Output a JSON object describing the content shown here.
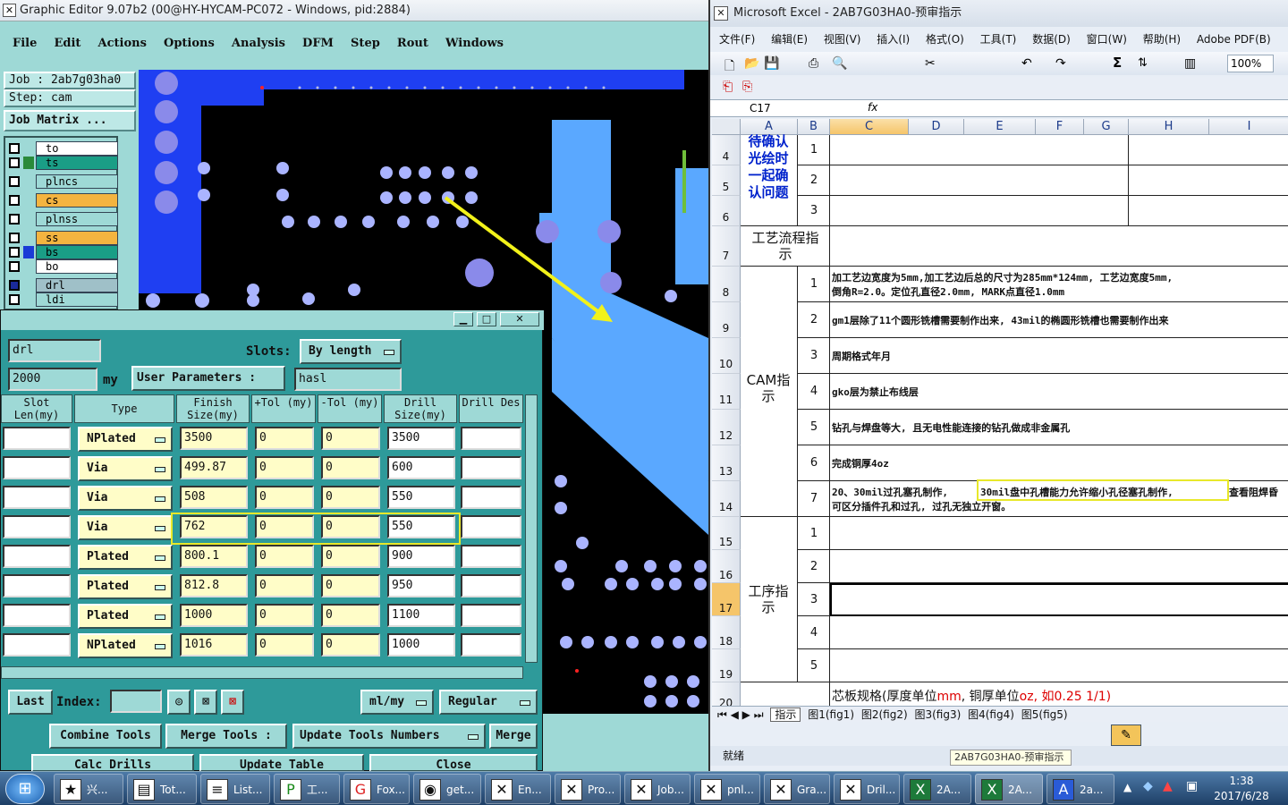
{
  "ge": {
    "title": "Graphic Editor 9.07b2 (00@HY-HYCAM-PC072 - Windows, pid:2884)",
    "menu": [
      "File",
      "Edit",
      "Actions",
      "Options",
      "Analysis",
      "DFM",
      "Step",
      "Rout",
      "Windows"
    ],
    "job_label": "Job : 2ab7g03ha0",
    "step_label": "Step: cam",
    "job_matrix": "Job Matrix ...",
    "layers": [
      {
        "name": "to",
        "color": "#ffffff"
      },
      {
        "name": "ts",
        "color": "#1a9e86"
      },
      {
        "name": "plncs",
        "color": "#9ed9d6"
      },
      {
        "name": "cs",
        "color": "#f4b440"
      },
      {
        "name": "plnss",
        "color": "#9ed9d6"
      },
      {
        "name": "ss",
        "color": "#f4b440"
      },
      {
        "name": "bs",
        "color": "#1a9e86"
      },
      {
        "name": "bo",
        "color": "#ffffff"
      },
      {
        "name": "drl",
        "color": "#9fc0c8"
      },
      {
        "name": "ldi",
        "color": "#9ed9d6"
      }
    ]
  },
  "dlg": {
    "layer_value": "drl",
    "slots_label": "Slots:",
    "slots_value": "By length",
    "thickness_value": "2000",
    "thickness_unit": "my",
    "user_params_label": "User Parameters :",
    "user_params_value": "hasl",
    "headers": [
      "Slot Len(my)",
      "Type",
      "Finish Size(my)",
      "+Tol (my)",
      "-Tol (my)",
      "Drill Size(my)",
      "Drill Des"
    ],
    "rows": [
      {
        "type": "NPlated",
        "finish": "3500",
        "ptol": "0",
        "ntol": "0",
        "drill": "3500"
      },
      {
        "type": "Via",
        "finish": "499.87",
        "ptol": "0",
        "ntol": "0",
        "drill": "600"
      },
      {
        "type": "Via",
        "finish": "508",
        "ptol": "0",
        "ntol": "0",
        "drill": "550"
      },
      {
        "type": "Via",
        "finish": "762",
        "ptol": "0",
        "ntol": "0",
        "drill": "550"
      },
      {
        "type": "Plated",
        "finish": "800.1",
        "ptol": "0",
        "ntol": "0",
        "drill": "900"
      },
      {
        "type": "Plated",
        "finish": "812.8",
        "ptol": "0",
        "ntol": "0",
        "drill": "950"
      },
      {
        "type": "Plated",
        "finish": "1000",
        "ptol": "0",
        "ntol": "0",
        "drill": "1100"
      },
      {
        "type": "NPlated",
        "finish": "1016",
        "ptol": "0",
        "ntol": "0",
        "drill": "1000"
      }
    ],
    "last_label": "Last",
    "index_label": "Index:",
    "unit_value": "ml/my",
    "mode_value": "Regular",
    "buttons": {
      "combine": "Combine Tools",
      "merge_tools": "Merge Tools :",
      "update_numbers": "Update Tools Numbers",
      "merge": "Merge",
      "calc": "Calc Drills",
      "update_table": "Update Table",
      "close": "Close"
    }
  },
  "xl": {
    "title": "Microsoft Excel - 2AB7G03HA0-预审指示",
    "menu": [
      "文件(F)",
      "编辑(E)",
      "视图(V)",
      "插入(I)",
      "格式(O)",
      "工具(T)",
      "数据(D)",
      "窗口(W)",
      "帮助(H)",
      "Adobe PDF(B)"
    ],
    "zoom": "100%",
    "namebox": "C17",
    "fx": "fx",
    "columns": [
      "A",
      "B",
      "C",
      "D",
      "E",
      "F",
      "G",
      "H",
      "I"
    ],
    "rows": [
      "4",
      "5",
      "6",
      "7",
      "8",
      "9",
      "10",
      "11",
      "12",
      "13",
      "14",
      "15",
      "16",
      "17",
      "18",
      "19",
      "20"
    ],
    "group_confirm": "待确认光绘时一起确认问题",
    "group_process": "工艺流程指示",
    "group_cam": "CAM指示",
    "group_step": "工序指示",
    "cam_items": [
      {
        "no": "1",
        "line1": "加工艺边宽度为5mm,加工艺边后总的尺寸为285mm*124mm, 工艺边宽度5mm,",
        "line2": "倒角R=2.0。定位孔直径2.0mm, MARK点直径1.0mm"
      },
      {
        "no": "2",
        "line1": "gm1层除了11个圆形铣槽需要制作出来, 43mil的椭圆形铣槽也需要制作出来",
        "line2": ""
      },
      {
        "no": "3",
        "line1": "周期格式年月",
        "line2": ""
      },
      {
        "no": "4",
        "line1": "gko层为禁止布线层",
        "line2": ""
      },
      {
        "no": "5",
        "line1": "钻孔与焊盘等大, 且无电性能连接的钻孔做成非金属孔",
        "line2": ""
      },
      {
        "no": "6",
        "line1": "完成铜厚4oz",
        "line2": ""
      },
      {
        "no": "7",
        "line1a": "20、30mil过孔塞孔制作,",
        "line1b": "30mil盘中孔槽能力允许缩小孔径塞孔制作,",
        "line1c": "查看阻焊昏",
        "line2": "可区分插件孔和过孔, 过孔无独立开窗。"
      }
    ],
    "confirm_nums": [
      "1",
      "2",
      "3"
    ],
    "step_nums": [
      "1",
      "2",
      "3",
      "4",
      "5"
    ],
    "core_spec_a": "芯板规格(厚度单位",
    "core_spec_mm": "mm",
    "core_spec_b": ", 铜厚单位",
    "core_spec_oz": "oz",
    "core_spec_c": ", 如0.25 1/1)",
    "sheet_tabs": [
      "指示",
      "图1(fig1)",
      "图2(fig2)",
      "图3(fig3)",
      "图4(fig4)",
      "图5(fig5)"
    ],
    "status": "就绪",
    "tooltip": "2AB7G03HA0-预审指示"
  },
  "taskbar": {
    "items": [
      "兴...",
      "Tot...",
      "List...",
      "工...",
      "Fox...",
      "get...",
      "En...",
      "Pro...",
      "Job...",
      "pnl...",
      "Gra...",
      "Dril...",
      "2A...",
      "2A...",
      "2a..."
    ],
    "time": "1:38",
    "date": "2017/6/28"
  }
}
